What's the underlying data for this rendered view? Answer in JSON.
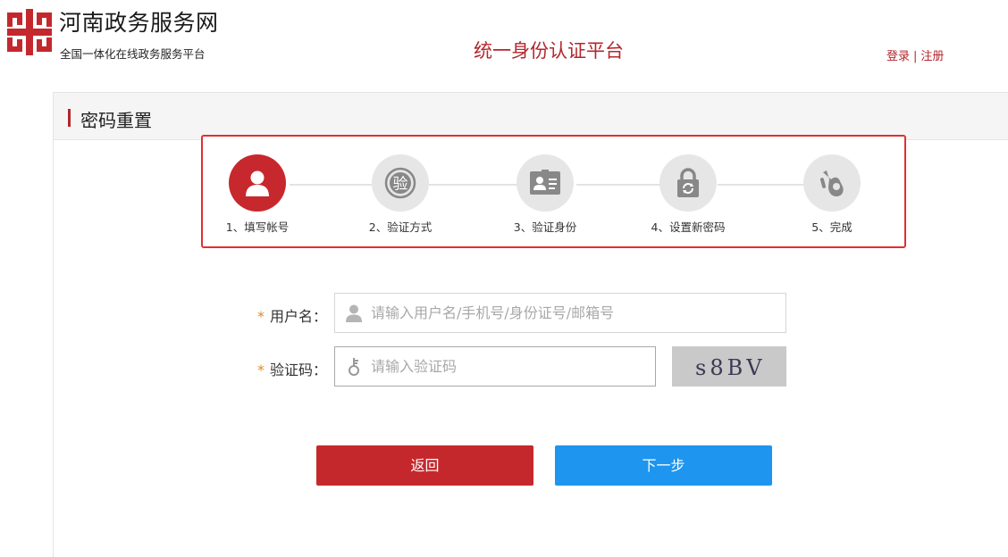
{
  "header": {
    "site_title": "河南政务服务网",
    "site_subtitle": "全国一体化在线政务服务平台",
    "platform_title": "统一身份认证平台",
    "login_label": "登录",
    "separator": "|",
    "register_label": "注册"
  },
  "panel": {
    "title": "密码重置"
  },
  "steps": [
    {
      "label": "1、填写帐号",
      "icon": "user-icon",
      "active": true
    },
    {
      "label": "2、验证方式",
      "icon": "verify-coin-icon",
      "glyph": "验",
      "active": false
    },
    {
      "label": "3、验证身份",
      "icon": "id-card-icon",
      "active": false
    },
    {
      "label": "4、设置新密码",
      "icon": "lock-refresh-icon",
      "active": false
    },
    {
      "label": "5、完成",
      "icon": "ok-hand-icon",
      "active": false
    }
  ],
  "form": {
    "required_mark": "*",
    "username": {
      "label": "用户名：",
      "value": "",
      "placeholder": "请输入用户名/手机号/身份证号/邮箱号",
      "icon": "user-icon"
    },
    "captcha": {
      "label": "验证码：",
      "value": "",
      "placeholder": "请输入验证码",
      "icon": "key-icon",
      "image_text": "s8BV"
    }
  },
  "buttons": {
    "back_label": "返回",
    "next_label": "下一步"
  },
  "colors": {
    "brand_red": "#c4282d",
    "primary_blue": "#1e95ee",
    "highlight_border": "#e0302f",
    "step_inactive": "#e6e6e6"
  }
}
